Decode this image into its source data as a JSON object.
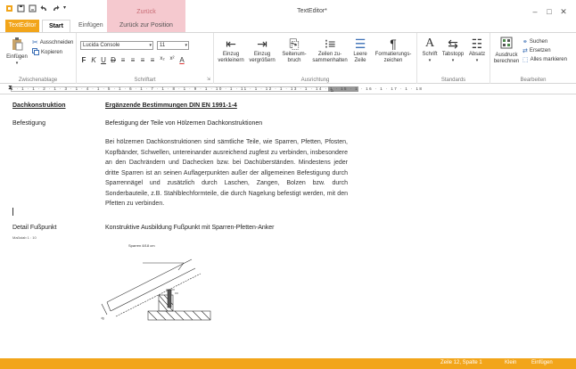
{
  "window": {
    "title": "TextEditor*",
    "context_title": "Zurück",
    "minimize": "–",
    "maximize": "□",
    "close": "✕"
  },
  "tabs": {
    "app": "TextEditor",
    "start": "Start",
    "insert": "Einfügen",
    "context": "Zurück zur Position"
  },
  "ribbon": {
    "clipboard": {
      "paste": "Einfügen",
      "cut": "Ausschneiden",
      "copy": "Kopieren",
      "label": "Zwischenablage"
    },
    "font": {
      "family": "Lucida Console",
      "size": "11",
      "formats": [
        "F",
        "K",
        "U",
        "D",
        "≡",
        "≡",
        "≡",
        "≡",
        "x₂",
        "x²",
        "A"
      ],
      "label": "Schriftart"
    },
    "alignment": {
      "buttons": [
        {
          "line1": "Einzug",
          "line2": "verkleinern"
        },
        {
          "line1": "Einzug",
          "line2": "vergrößern"
        },
        {
          "line1": "Seitenum-",
          "line2": "bruch"
        },
        {
          "line1": "Zeilen zu-",
          "line2": "sammenhalten"
        },
        {
          "line1": "Leere",
          "line2": "Zeile"
        },
        {
          "line1": "Formatierungs-",
          "line2": "zeichen"
        }
      ],
      "label": "Ausrichtung"
    },
    "standards": {
      "buttons": [
        "Schrift",
        "Tabstopp",
        "Absatz"
      ],
      "label": "Standards"
    },
    "edit": {
      "print_line1": "Ausdruck",
      "print_line2": "berechnen",
      "search": "Suchen",
      "replace": "Ersetzen",
      "select_all": "Alles markieren",
      "label": "Bearbeiten"
    }
  },
  "ruler": {
    "ticks": "1 · 1 · 1 · 2 · 1 · 3 · 1 · 4 · 1 · 5 · 1 · 6 · 1 · 7 · 1 · 8 · 1 · 9 · 1 · 10 · 1 · 11 · 1 · 12 · 1 · 13 · 1 · 14 · 1 · 15 · 1 · 16 · 1 · 17 · 1 · 18"
  },
  "document": {
    "heading_left": "Dachkonstruktion",
    "heading_right": "Ergänzende Bestimmungen DIN EN 1991-1-4",
    "section_left": "Befestigung",
    "section_right": "Befestigung der Teile von Hölzernen Dachkonstruktionen",
    "paragraph": "Bei hölzernen Dachkonstruktionen sind sämtliche Teile, wie Sparren, Pfetten, Pfosten, Kopfbänder, Schwellen, untereinander ausreichend zugfest zu verbinden, insbesondere an den Dachrändern und Dachecken bzw. bei Dachüberständen. Mindestens jeder dritte Sparren ist an seinen Auflagerpunkten außer der allgemeinen Befestigung durch Sparrennägel und zusätzlich durch Laschen, Zangen, Bolzen bzw. durch Sonderbauteile, z.B. Stahlblechformteile, die durch Nagelung befestigt werden, mit den Pfetten zu verbinden.",
    "detail_left": "Detail Fußpunkt",
    "detail_right": "Konstruktive Ausbildung Fußpunkt mit Sparren-Pfetten-Anker",
    "scale": "Maßstab 1 : 10",
    "drawing_label": "Sparren 8/18 cm"
  },
  "status": {
    "position": "Zeile 12, Spalte 1",
    "lang": "Klein",
    "mode": "Einfügen"
  }
}
